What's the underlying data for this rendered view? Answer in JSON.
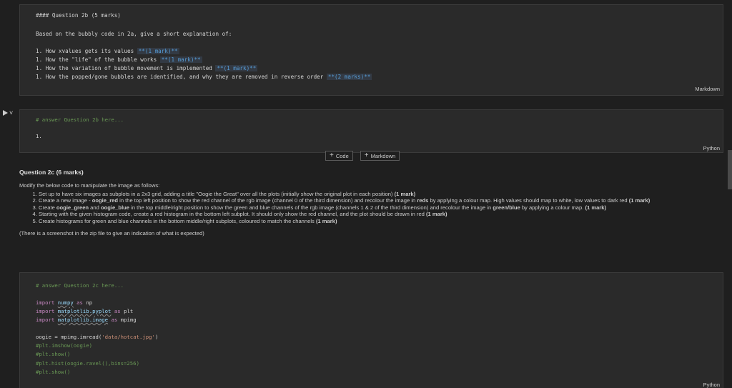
{
  "md_cell_1": {
    "heading": "#### Question 2b (5 marks)",
    "intro": "Based on the bubbly code in 2a, give a short explanation of:",
    "items": [
      {
        "text": "1. How xvalues gets its values ",
        "marks": "**(1 mark)**"
      },
      {
        "text": "1. How the \"life\" of the bubble works ",
        "marks": "**(1 mark)**"
      },
      {
        "text": "1. How the variation of bubble movement is implemented ",
        "marks": "**(1 mark)**"
      },
      {
        "text": "1. How the popped/gone bubbles are identified, and why they are removed in reverse order ",
        "marks": "**(2 marks)**"
      }
    ],
    "lang": "Markdown"
  },
  "code_cell_1": {
    "comment": "# answer Question 2b here...",
    "line2": "1.",
    "lang": "Python"
  },
  "add_bar": {
    "code_label": "Code",
    "markdown_label": "Markdown"
  },
  "md_output": {
    "heading": "Question 2c (6 marks)",
    "intro": "Modify the below code to manipulate the image as follows:",
    "items": [
      {
        "pre": "Set up to have six images as subplots in a 2x3 grid, adding a title \"Oogie the Great\" over all the plots (initially show the original plot in each position) ",
        "bold": "(1 mark)"
      },
      {
        "pre": "Create a new image - ",
        "b1": "oogie_red",
        "mid": " in the top left position to show the red channel of the rgb image (channel 0 of the third dimension) and recolour the image in ",
        "b2": "reds",
        "post": " by applying a colour map. High values should map to white, low values to dark red ",
        "bold": "(1 mark)"
      },
      {
        "pre": "Create ",
        "b1": "oogie_green",
        "mid": " and ",
        "b2": "oogie_blue",
        "post": " in the top middle/right position to show the green and blue channels of the rgb image (channels 1 & 2 of the third dimension) and recolour the image in ",
        "b3": "green/blue",
        "post2": " by applying a colour map. ",
        "bold": "(1 mark)"
      },
      {
        "pre": "Starting with the given histogram code, create a red histogram in the bottom left subplot. It should only show the red channel, and the plot should be drawn in red ",
        "bold": "(1 mark)"
      },
      {
        "pre": "Create histograms for green and blue channels in the bottom middle/right subplots, coloured to match the channels ",
        "bold": "(1 mark)"
      }
    ],
    "footer": "(There is a screenshot in the zip file to give an indication of what is expected)"
  },
  "code_cell_2": {
    "comment": "# answer Question 2c here...",
    "import1_mod": "numpy",
    "import1_alias": "np",
    "import2_mod": "matplotlib.pyplot",
    "import2_alias": "plt",
    "import3_mod": "matplotlib.image",
    "import3_alias": "mpimg",
    "kw_import": "import",
    "kw_as": "as",
    "assign_var": "oogie",
    "assign_call": " = mpimg.imread(",
    "assign_str": "'data/hotcat.jpg'",
    "assign_end": ")",
    "c1": "#plt.imshow(oogie)",
    "c2": "#plt.show()",
    "c3": "#plt.hist(oogie.ravel(),bins=256)",
    "c4": "#plt.show()",
    "lang": "Python"
  }
}
